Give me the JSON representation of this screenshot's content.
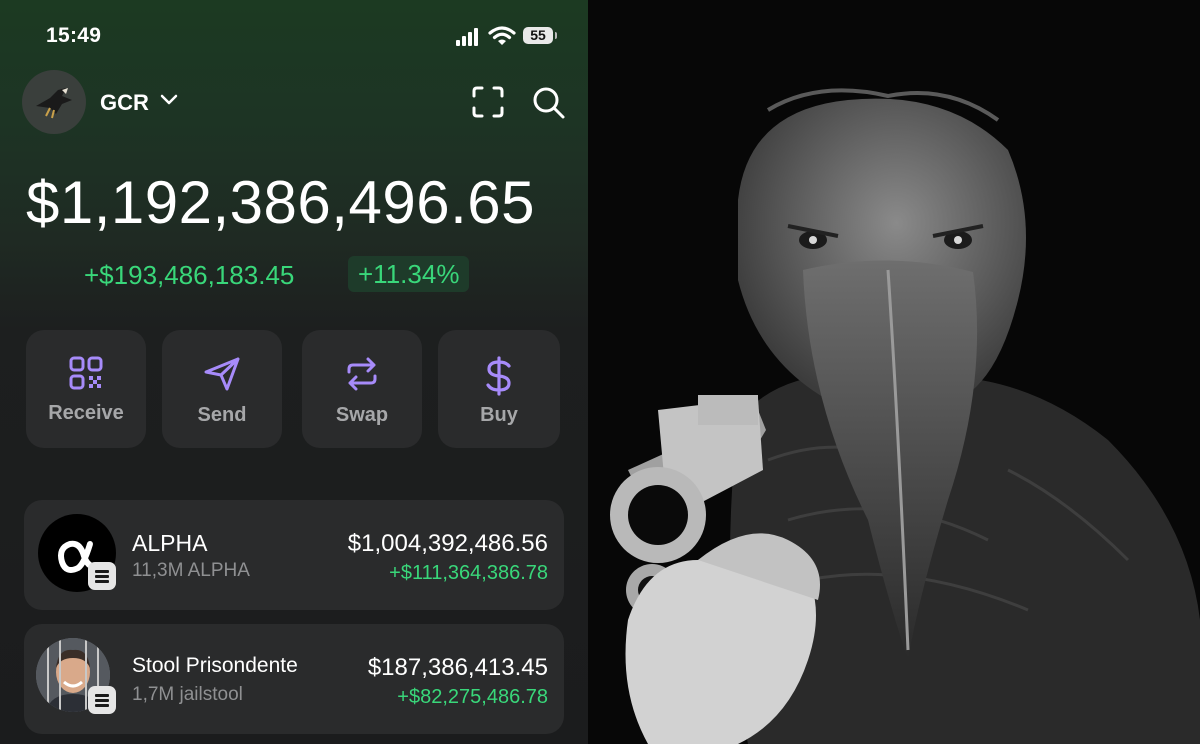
{
  "status": {
    "time": "15:49",
    "battery": "55"
  },
  "header": {
    "account": "GCR"
  },
  "wallet": {
    "balance": "$1,192,386,496.65",
    "change": "+$193,486,183.45",
    "change_pct": "+11.34%"
  },
  "actions": [
    {
      "label": "Receive",
      "icon": "qr-code-icon"
    },
    {
      "label": "Send",
      "icon": "send-icon"
    },
    {
      "label": "Swap",
      "icon": "swap-icon"
    },
    {
      "label": "Buy",
      "icon": "dollar-icon"
    }
  ],
  "tokens": [
    {
      "name": "ALPHA",
      "amount": "11,3M ALPHA",
      "value": "$1,004,392,486.56",
      "change": "+$111,364,386.78"
    },
    {
      "name": "Stool Prisondente",
      "amount": "1,7M jailstool",
      "value": "$187,386,413.45",
      "change": "+$82,275,486.78"
    }
  ],
  "colors": {
    "accent_green": "#39d77a",
    "action_icon": "#a78bfa",
    "card_bg": "#2a2b2c"
  }
}
